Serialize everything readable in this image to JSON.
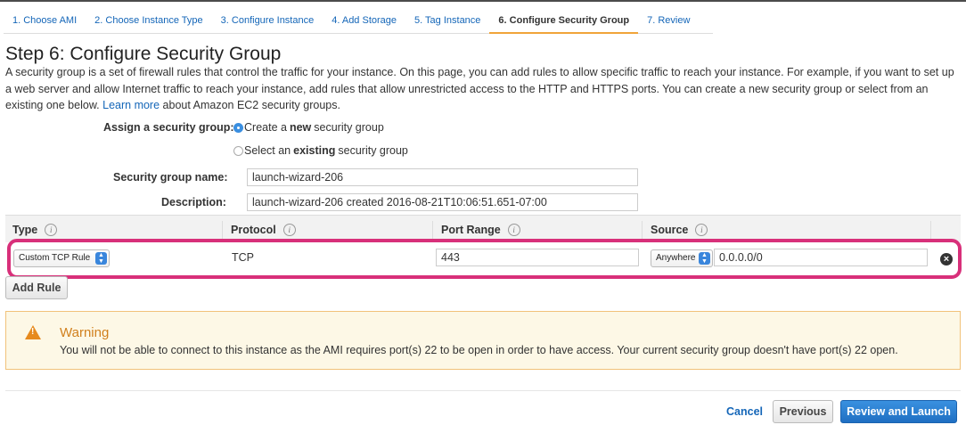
{
  "wizard_tabs": [
    {
      "label": "1. Choose AMI"
    },
    {
      "label": "2. Choose Instance Type"
    },
    {
      "label": "3. Configure Instance"
    },
    {
      "label": "4. Add Storage"
    },
    {
      "label": "5. Tag Instance"
    },
    {
      "label": "6. Configure Security Group",
      "active": true
    },
    {
      "label": "7. Review"
    }
  ],
  "page": {
    "title": "Step 6: Configure Security Group",
    "intro_text": "A security group is a set of firewall rules that control the traffic for your instance. On this page, you can add rules to allow specific traffic to reach your instance. For example, if you want to set up a web server and allow Internet traffic to reach your instance, add rules that allow unrestricted access to the HTTP and HTTPS ports. You can create a new security group or select from an existing one below.",
    "learn_more_link": "Learn more",
    "intro_suffix": "about Amazon EC2 security groups."
  },
  "assign": {
    "label": "Assign a security group:",
    "option_create_prefix": "Create a ",
    "option_create_bold": "new",
    "option_create_suffix": " security group",
    "option_existing_prefix": "Select an ",
    "option_existing_bold": "existing",
    "option_existing_suffix": " security group",
    "selected": "create"
  },
  "form": {
    "name_label": "Security group name:",
    "name_value": "launch-wizard-206",
    "description_label": "Description:",
    "description_value": "launch-wizard-206 created 2016-08-21T10:06:51.651-07:00"
  },
  "rules_table": {
    "columns": [
      "Type",
      "Protocol",
      "Port Range",
      "Source"
    ],
    "rows": [
      {
        "type": "Custom TCP Rule",
        "protocol": "TCP",
        "port_range": "443",
        "source_select": "Anywhere",
        "source_value": "0.0.0.0/0"
      }
    ],
    "add_rule_label": "Add Rule"
  },
  "warning": {
    "title": "Warning",
    "text": "You will not be able to connect to this instance as the AMI requires port(s) 22 to be open in order to have access. Your current security group doesn't have port(s) 22 open."
  },
  "footer": {
    "cancel_label": "Cancel",
    "previous_label": "Previous",
    "review_launch_label": "Review and Launch"
  },
  "colors": {
    "link": "#1466b8",
    "active_tab_underline": "#f0a43a",
    "highlight_border": "#d8307a",
    "warning_title": "#d1801d",
    "primary_button": "#1f6fc2"
  }
}
